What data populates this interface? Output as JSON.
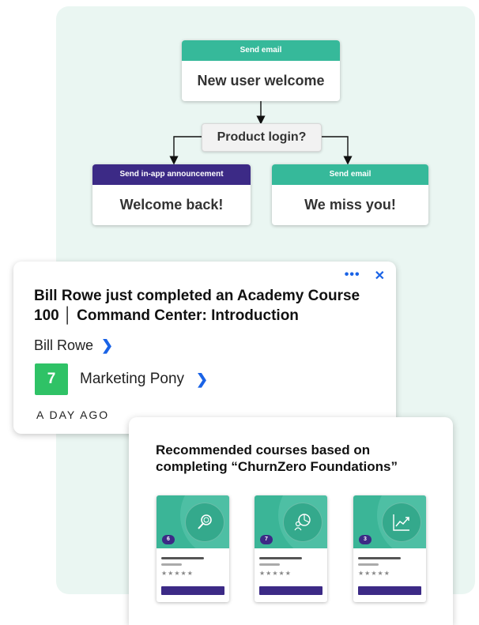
{
  "flow": {
    "start": {
      "header": "Send email",
      "title": "New user welcome"
    },
    "decision": "Product login?",
    "branch_left": {
      "header": "Send in-app announcement",
      "title": "Welcome back!"
    },
    "branch_right": {
      "header": "Send email",
      "title": "We miss you!"
    }
  },
  "notification": {
    "title": "Bill Rowe just completed an Academy Course 100 │ Command Center: Introduction",
    "person": "Bill Rowe",
    "account_badge": "7",
    "account_name": "Marketing Pony",
    "time": "A DAY AGO",
    "icons": {
      "more": "more-dots-icon",
      "close": "close-icon",
      "chevron": "chevron-right-icon"
    },
    "colors": {
      "accent": "#1a63e6",
      "badge": "#2fc266"
    }
  },
  "recommendations": {
    "heading": "Recommended courses based on completing “ChurnZero Foundations”",
    "courses": [
      {
        "number": "6",
        "icon": "search-magnify-icon",
        "stars": "★★★★★"
      },
      {
        "number": "7",
        "icon": "user-pie-chart-icon",
        "stars": "★★★★★"
      },
      {
        "number": "3",
        "icon": "line-chart-icon",
        "stars": "★★★★★"
      }
    ],
    "colors": {
      "teal": "#3bb597",
      "purple": "#3c2a86"
    }
  }
}
